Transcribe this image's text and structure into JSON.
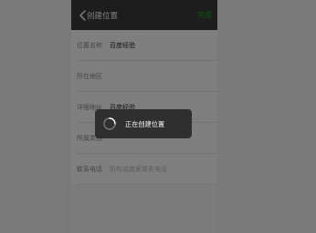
{
  "nav": {
    "title": "创建位置",
    "done_label": "完成"
  },
  "form": {
    "rows": [
      {
        "label": "位置名称",
        "value": "百度经验",
        "placeholder": false
      },
      {
        "label": "所在地区",
        "value": "",
        "placeholder": true
      },
      {
        "label": "详细地址",
        "value": "百度经验",
        "placeholder": false
      },
      {
        "label": "所属类别",
        "value": "",
        "placeholder": true
      },
      {
        "label": "联系电话",
        "value": "机构或商家联系电话",
        "placeholder": true
      }
    ]
  },
  "toast": {
    "text": "正在创建位置"
  },
  "colors": {
    "nav_bg": "#3a3a3a",
    "accent_green": "#1aad19"
  },
  "icons": [
    "back-arrow-icon",
    "loading-spinner-icon"
  ]
}
